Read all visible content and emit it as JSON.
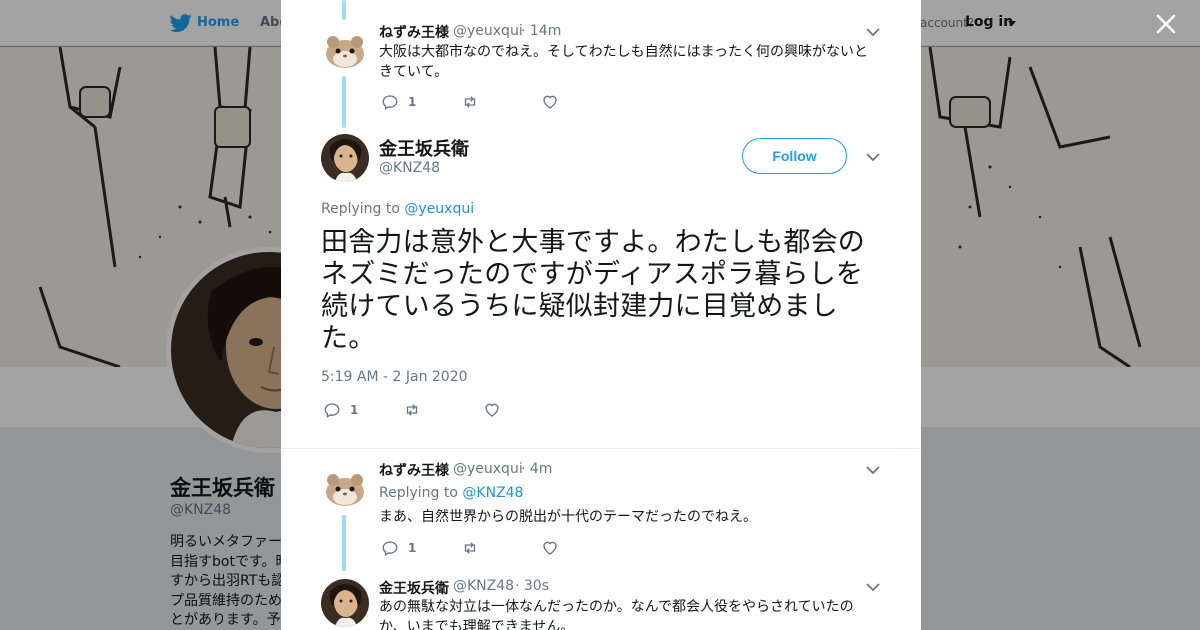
{
  "background": {
    "nav": {
      "home": "Home",
      "about": "Abo",
      "account_prompt": "account?",
      "login": "Log in"
    },
    "profile": {
      "name": "金王坂兵衛",
      "handle": "@KNZ48",
      "bio_lines": [
        "明るいメタファー",
        "目指すbotです。時",
        "すから出羽RTも認",
        "プ品質維持のため",
        "とがあります。予"
      ]
    }
  },
  "modal": {
    "close_icon": "close-icon",
    "tweets": [
      {
        "name": "ねずみ王様",
        "handle": "@yeuxqui",
        "time": "· 14m",
        "text": "大阪は大都市なのでねえ。そしてわたしも自然にはまったく何の興味がないときていて。",
        "reply_count": "1"
      },
      {
        "name": "ねずみ王様",
        "handle": "@yeuxqui",
        "time": "· 4m",
        "replying_prefix": "Replying to",
        "replying_to": "@KNZ48",
        "text": "まあ、自然世界からの脱出が十代のテーマだったのでねえ。",
        "reply_count": "1"
      },
      {
        "name": "金王坂兵衛",
        "handle": "@KNZ48",
        "time": "· 30s",
        "text": "あの無駄な対立は一体なんだったのか。なんで都会人役をやらされていたのか、いまでも理解できません。"
      }
    ],
    "main_tweet": {
      "name": "金王坂兵衛",
      "handle": "@KNZ48",
      "follow_label": "Follow",
      "replying_prefix": "Replying to",
      "replying_to": "@yeuxqui",
      "text": "田舎力は意外と大事ですよ。わたしも都会のネズミだったのですがディアスポラ暮らしを続けているうちに疑似封建力に目覚めました。",
      "timestamp": "5:19 AM - 2 Jan 2020",
      "reply_count": "1"
    }
  },
  "colors": {
    "accent": "#1da1f2",
    "link": "#1b95e0",
    "thread_line": "#9fd9f9",
    "muted": "#657786",
    "text": "#14171a"
  }
}
